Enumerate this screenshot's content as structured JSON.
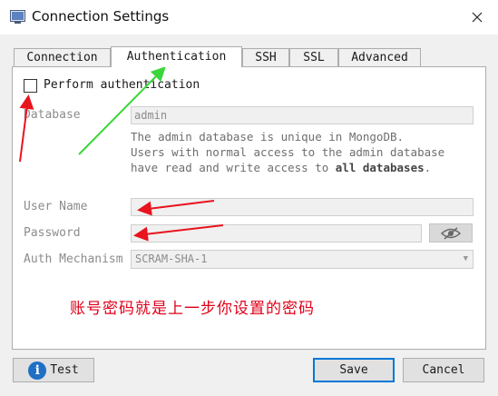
{
  "window": {
    "title": "Connection Settings",
    "icon": "app-window-icon"
  },
  "tabs": [
    {
      "label": "Connection",
      "active": false
    },
    {
      "label": "Authentication",
      "active": true
    },
    {
      "label": "SSH",
      "active": false
    },
    {
      "label": "SSL",
      "active": false
    },
    {
      "label": "Advanced",
      "active": false
    }
  ],
  "auth": {
    "perform_label": "Perform authentication",
    "perform_checked": false,
    "database_label": "Database",
    "database_value": "admin",
    "description_line1": "The  admin  database  is  unique  in  MongoDB.",
    "description_line2": "Users with normal access to the admin database",
    "description_line3_pre": "have read and write access to ",
    "description_line3_bold": "all databases",
    "description_line3_post": ".",
    "username_label": "User Name",
    "username_value": "",
    "password_label": "Password",
    "password_value": "",
    "mechanism_label": "Auth Mechanism",
    "mechanism_value": "SCRAM-SHA-1"
  },
  "annotation": {
    "note": "账号密码就是上一步你设置的密码",
    "arrow_color": "#e8141e",
    "green_arrow_color": "#3bd63b"
  },
  "buttons": {
    "test": "Test",
    "save": "Save",
    "cancel": "Cancel"
  },
  "colors": {
    "accent": "#0078d7",
    "info": "#1f6fc5"
  }
}
